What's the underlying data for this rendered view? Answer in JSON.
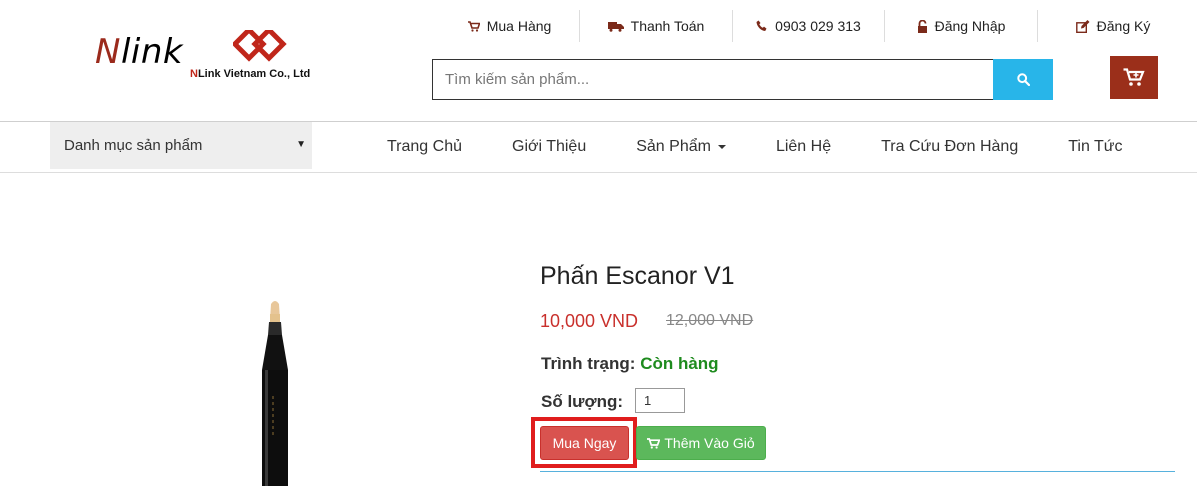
{
  "logo": {
    "prefix": "N",
    "main": "link",
    "sub_prefix": "N",
    "sub_main": "Link Vietnam Co., Ltd"
  },
  "topnav": [
    {
      "label": "Mua Hàng",
      "icon": "cart-icon"
    },
    {
      "label": "Thanh Toán",
      "icon": "truck-icon"
    },
    {
      "label": "0903 029 313",
      "icon": "phone-icon"
    },
    {
      "label": "Đăng Nhập",
      "icon": "lock-icon"
    },
    {
      "label": "Đăng Ký",
      "icon": "edit-icon"
    }
  ],
  "search": {
    "placeholder": "Tìm kiếm sản phẩm..."
  },
  "category": {
    "label": "Danh mục sản phẩm"
  },
  "menu": [
    {
      "label": "Trang Chủ"
    },
    {
      "label": "Giới Thiệu"
    },
    {
      "label": "Sản Phẩm"
    },
    {
      "label": "Liên Hệ"
    },
    {
      "label": "Tra Cứu Đơn Hàng"
    },
    {
      "label": "Tin Tức"
    }
  ],
  "product": {
    "title": "Phấn Escanor V1",
    "price": "10,000 VND",
    "old_price": "12,000 VND",
    "status_label": "Trình trạng:",
    "status_value": "Còn hàng",
    "qty_label": "Số lượng:",
    "qty_value": "1",
    "buy_label": "Mua Ngay",
    "add_label": "Thêm Vào Giỏ"
  },
  "colors": {
    "brand": "#9b2f1a",
    "search_button": "#28b5e9",
    "price": "#c9302c",
    "in_stock": "#1e8b1e",
    "buy_button": "#d9534f",
    "add_button": "#5cb85c",
    "highlight": "#e01d1d"
  }
}
